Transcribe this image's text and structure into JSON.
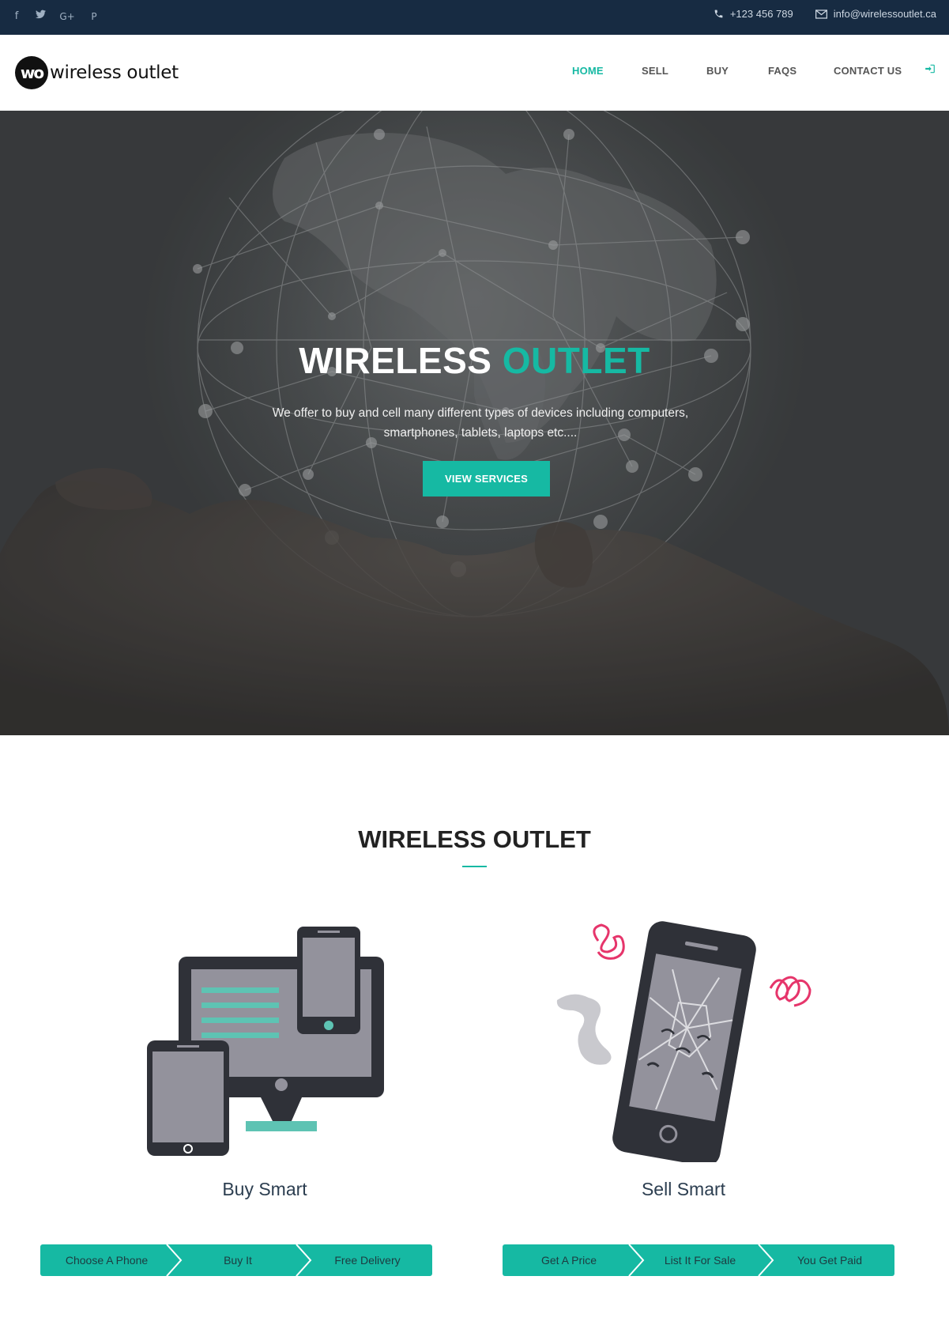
{
  "topbar": {
    "social": [
      {
        "icon": "facebook-icon",
        "glyph": "f"
      },
      {
        "icon": "twitter-icon",
        "glyph": "🐦"
      },
      {
        "icon": "google-plus-icon",
        "glyph": "G+"
      },
      {
        "icon": "pinterest-icon",
        "glyph": "P"
      }
    ],
    "phone": "+123 456 789",
    "email": "info@wirelessoutlet.ca"
  },
  "nav": {
    "logo_mark": "wo",
    "logo_text": "wireless outlet",
    "items": [
      {
        "label": "HOME",
        "active": true
      },
      {
        "label": "SELL",
        "active": false
      },
      {
        "label": "BUY",
        "active": false
      },
      {
        "label": "FAQS",
        "active": false
      },
      {
        "label": "CONTACT US",
        "active": false
      }
    ],
    "login_icon": "sign-in-icon"
  },
  "hero": {
    "title_main": "WIRELESS",
    "title_accent": "OUTLET",
    "subtitle": "We offer to buy and cell many different types of devices including computers, smartphones, tablets, laptops etc....",
    "button": "VIEW SERVICES"
  },
  "section": {
    "title": "WIRELESS OUTLET",
    "cards": [
      {
        "title": "Buy Smart",
        "steps": [
          "Choose A Phone",
          "Buy It",
          "Free Delivery"
        ]
      },
      {
        "title": "Sell Smart",
        "steps": [
          "Get A Price",
          "List It For Sale",
          "You Get Paid"
        ]
      }
    ]
  },
  "colors": {
    "accent": "#16b9a3",
    "topbar": "#172b42",
    "device_dark": "#2f3138",
    "device_screen": "#93929c"
  }
}
